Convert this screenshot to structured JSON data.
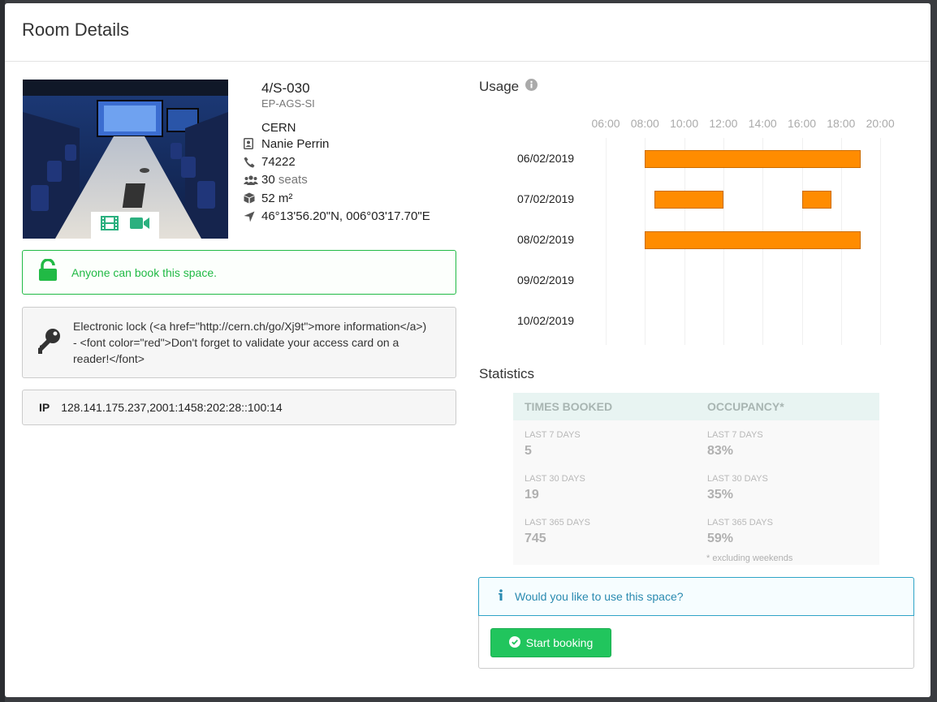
{
  "modal": {
    "title": "Room Details"
  },
  "room": {
    "name": "4/S-030",
    "division": "EP-AGS-SI",
    "site": "CERN",
    "owner": "Nanie Perrin",
    "phone": "74222",
    "seats_count": "30",
    "seats_word": "seats",
    "surface": "52 m²",
    "coordinates": "46°13'56.20\"N, 006°03'17.70\"E"
  },
  "photo": {
    "tab_icons": [
      "film-icon",
      "video-camera-icon"
    ]
  },
  "messages": {
    "public": "Anyone can book this space.",
    "lock": "Electronic lock (<a href=\"http://cern.ch/go/Xj9t\">more information</a>) - <font color=\"red\">Don't forget to validate your access card on a reader!</font>",
    "ip_label": "IP",
    "ip_value": "128.141.175.237,2001:1458:202:28::100:14"
  },
  "usage": {
    "title": "Usage",
    "hours": [
      "06:00",
      "08:00",
      "10:00",
      "12:00",
      "14:00",
      "16:00",
      "18:00",
      "20:00"
    ],
    "days": [
      {
        "date": "06/02/2019",
        "bookings": [
          [
            8.0,
            19.0
          ]
        ]
      },
      {
        "date": "07/02/2019",
        "bookings": [
          [
            8.5,
            12.0
          ],
          [
            16.0,
            17.5
          ]
        ]
      },
      {
        "date": "08/02/2019",
        "bookings": [
          [
            8.0,
            19.0
          ]
        ]
      },
      {
        "date": "09/02/2019",
        "bookings": []
      },
      {
        "date": "10/02/2019",
        "bookings": []
      }
    ]
  },
  "statistics": {
    "title": "Statistics",
    "times_booked_header": "TIMES BOOKED",
    "occupancy_header": "OCCUPANCY*",
    "rows": [
      {
        "label": "LAST 7 DAYS",
        "times": "5",
        "occ_label": "LAST 7 DAYS",
        "occupancy": "83%"
      },
      {
        "label": "LAST 30 DAYS",
        "times": "19",
        "occ_label": "LAST 30 DAYS",
        "occupancy": "35%"
      },
      {
        "label": "LAST 365 DAYS",
        "times": "745",
        "occ_label": "LAST 365 DAYS",
        "occupancy": "59%"
      }
    ],
    "footnote": "* excluding weekends"
  },
  "booking": {
    "question": "Would you like to use this space?",
    "button": "Start booking"
  },
  "colors": {
    "bar": "#ff8c00",
    "success": "#21ba45",
    "info": "#2a8ab0",
    "button": "#21c55d"
  }
}
